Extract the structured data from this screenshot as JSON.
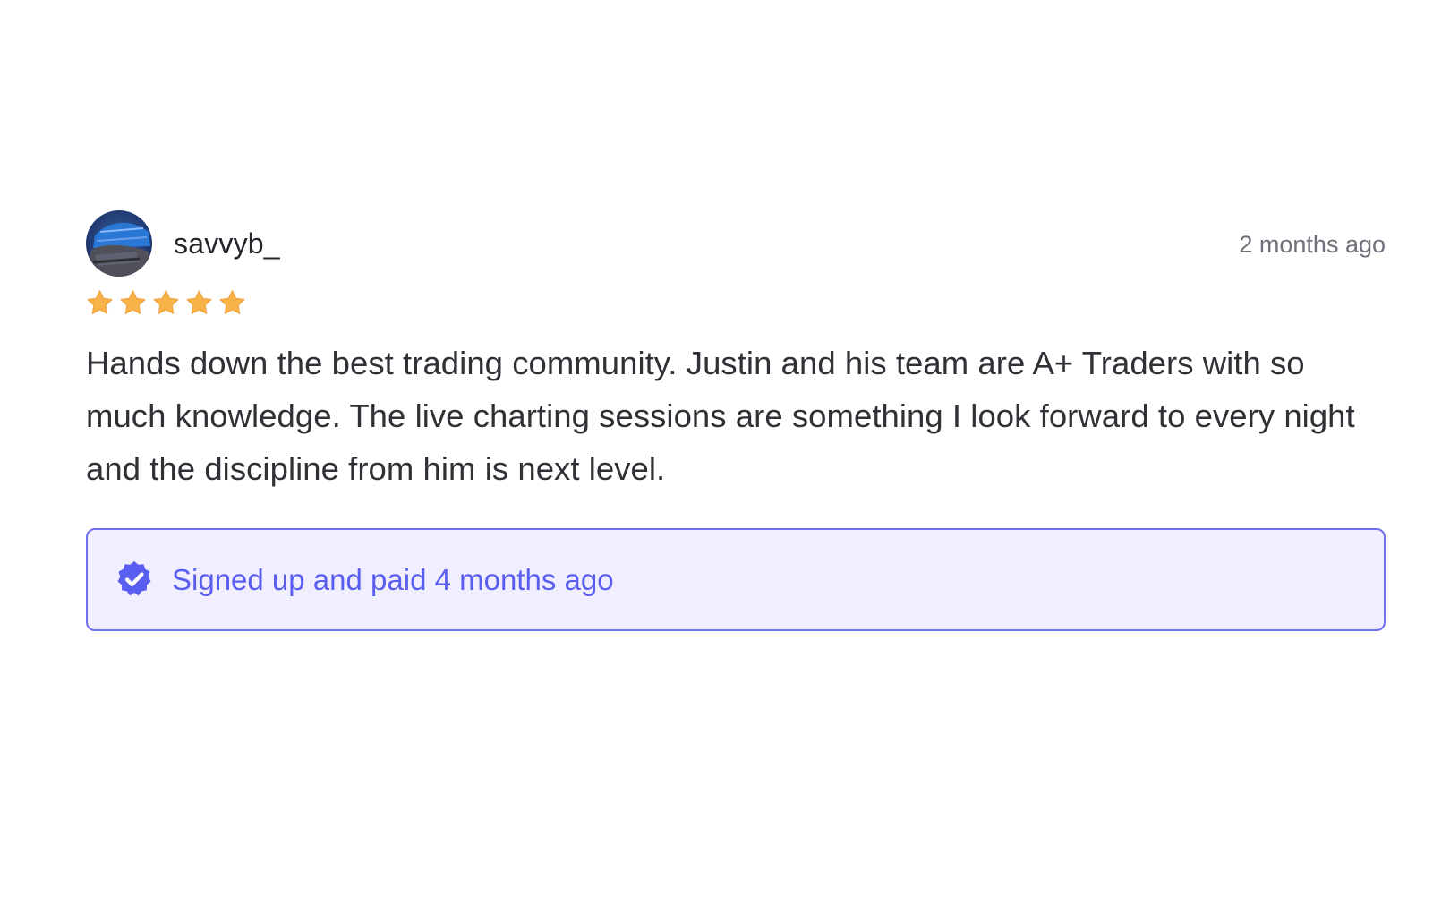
{
  "review": {
    "username": "savvyb_",
    "timestamp": "2 months ago",
    "rating": 5,
    "rating_max": 5,
    "text": "Hands down the best trading community. Justin and his team are A+ Traders with so much knowledge. The live charting sessions are something I look forward to every night and the discipline from him is next level.",
    "verified_text": "Signed up and paid 4 months ago"
  },
  "icons": {
    "avatar": "user-avatar",
    "star": "star-icon",
    "verified": "verified-badge-icon"
  },
  "colors": {
    "star": "#f7b24a",
    "accent": "#5a5ef0",
    "verified_border": "#6f70f0",
    "verified_background": "#f1efff",
    "timestamp": "#6f717a"
  }
}
